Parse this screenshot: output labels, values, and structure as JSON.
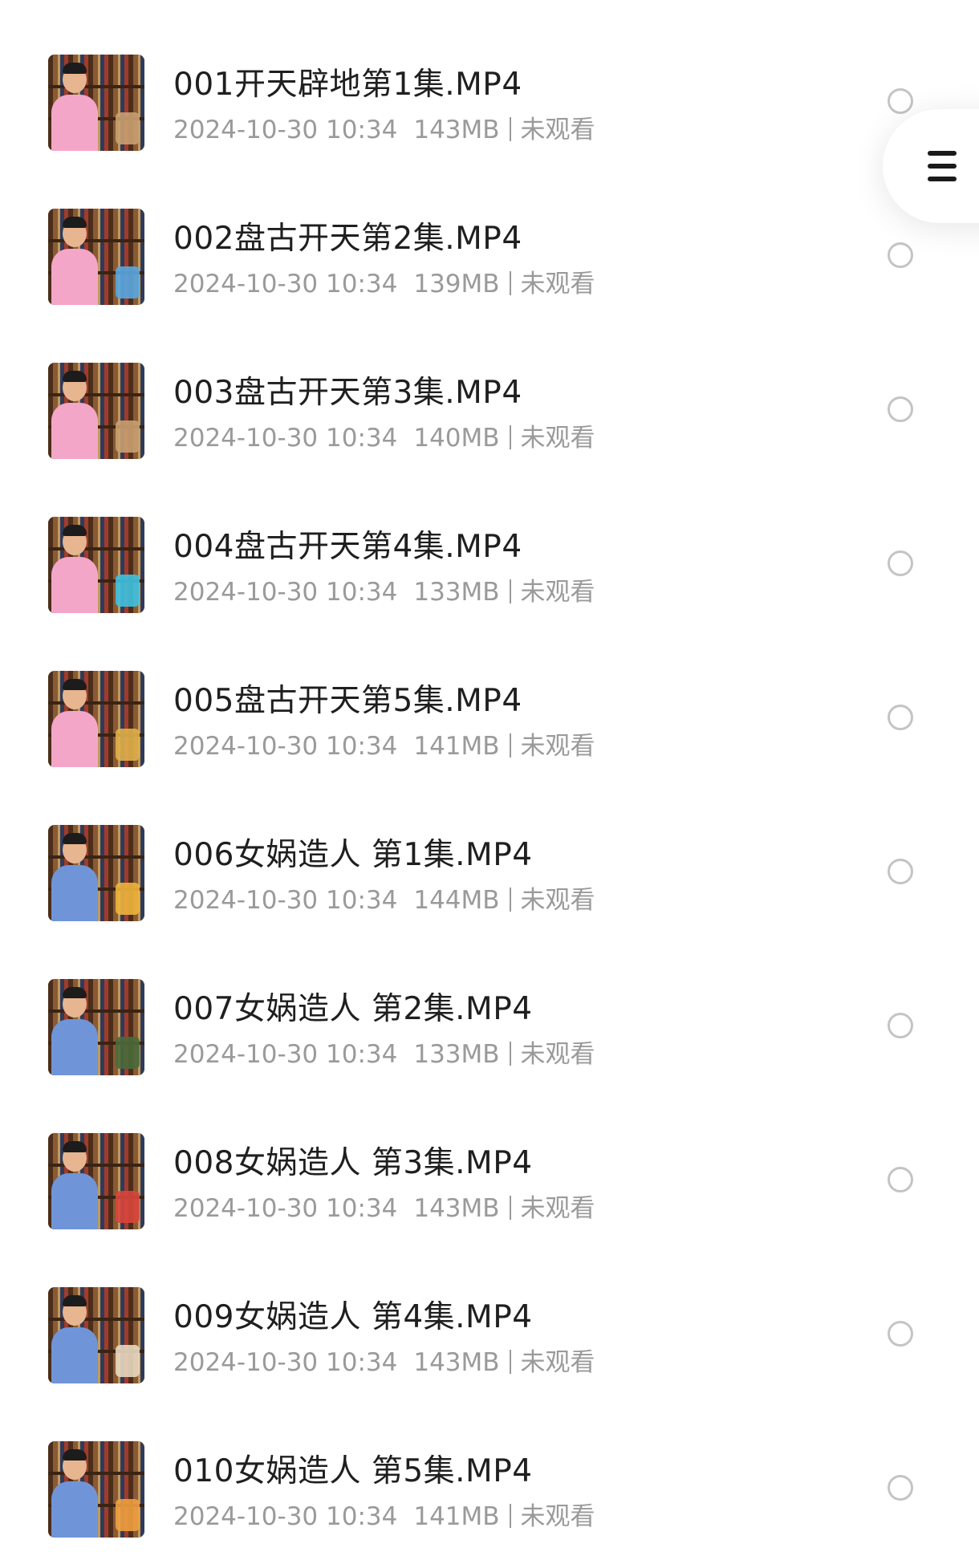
{
  "videos": [
    {
      "title": "001开天辟地第1集.MP4",
      "datetime": "2024-10-30 10:34",
      "size": "143MB",
      "status": "未观看",
      "thumb_colors": {
        "shirt": "#f4a6c8",
        "prop": "#c9a070"
      }
    },
    {
      "title": "002盘古开天第2集.MP4",
      "datetime": "2024-10-30 10:34",
      "size": "139MB",
      "status": "未观看",
      "thumb_colors": {
        "shirt": "#f4a6c8",
        "prop": "#5aa7e0"
      }
    },
    {
      "title": "003盘古开天第3集.MP4",
      "datetime": "2024-10-30 10:34",
      "size": "140MB",
      "status": "未观看",
      "thumb_colors": {
        "shirt": "#f4a6c8",
        "prop": "#c9a070"
      }
    },
    {
      "title": "004盘古开天第4集.MP4",
      "datetime": "2024-10-30 10:34",
      "size": "133MB",
      "status": "未观看",
      "thumb_colors": {
        "shirt": "#f4a6c8",
        "prop": "#3fc2e0"
      }
    },
    {
      "title": "005盘古开天第5集.MP4",
      "datetime": "2024-10-30 10:34",
      "size": "141MB",
      "status": "未观看",
      "thumb_colors": {
        "shirt": "#f4a6c8",
        "prop": "#e0b04a"
      }
    },
    {
      "title": "006女娲造人 第1集.MP4",
      "datetime": "2024-10-30 10:34",
      "size": "144MB",
      "status": "未观看",
      "thumb_colors": {
        "shirt": "#6f95d8",
        "prop": "#f0b43c"
      }
    },
    {
      "title": "007女娲造人 第2集.MP4",
      "datetime": "2024-10-30 10:34",
      "size": "133MB",
      "status": "未观看",
      "thumb_colors": {
        "shirt": "#6f95d8",
        "prop": "#4a6a3a"
      }
    },
    {
      "title": "008女娲造人 第3集.MP4",
      "datetime": "2024-10-30 10:34",
      "size": "143MB",
      "status": "未观看",
      "thumb_colors": {
        "shirt": "#6f95d8",
        "prop": "#d8463c"
      }
    },
    {
      "title": "009女娲造人 第4集.MP4",
      "datetime": "2024-10-30 10:34",
      "size": "143MB",
      "status": "未观看",
      "thumb_colors": {
        "shirt": "#6f95d8",
        "prop": "#e8d8c0"
      }
    },
    {
      "title": "010女娲造人 第5集.MP4",
      "datetime": "2024-10-30 10:34",
      "size": "141MB",
      "status": "未观看",
      "thumb_colors": {
        "shirt": "#6f95d8",
        "prop": "#f0a040"
      }
    }
  ],
  "menu_button": {
    "icon": "hamburger-menu-icon"
  }
}
